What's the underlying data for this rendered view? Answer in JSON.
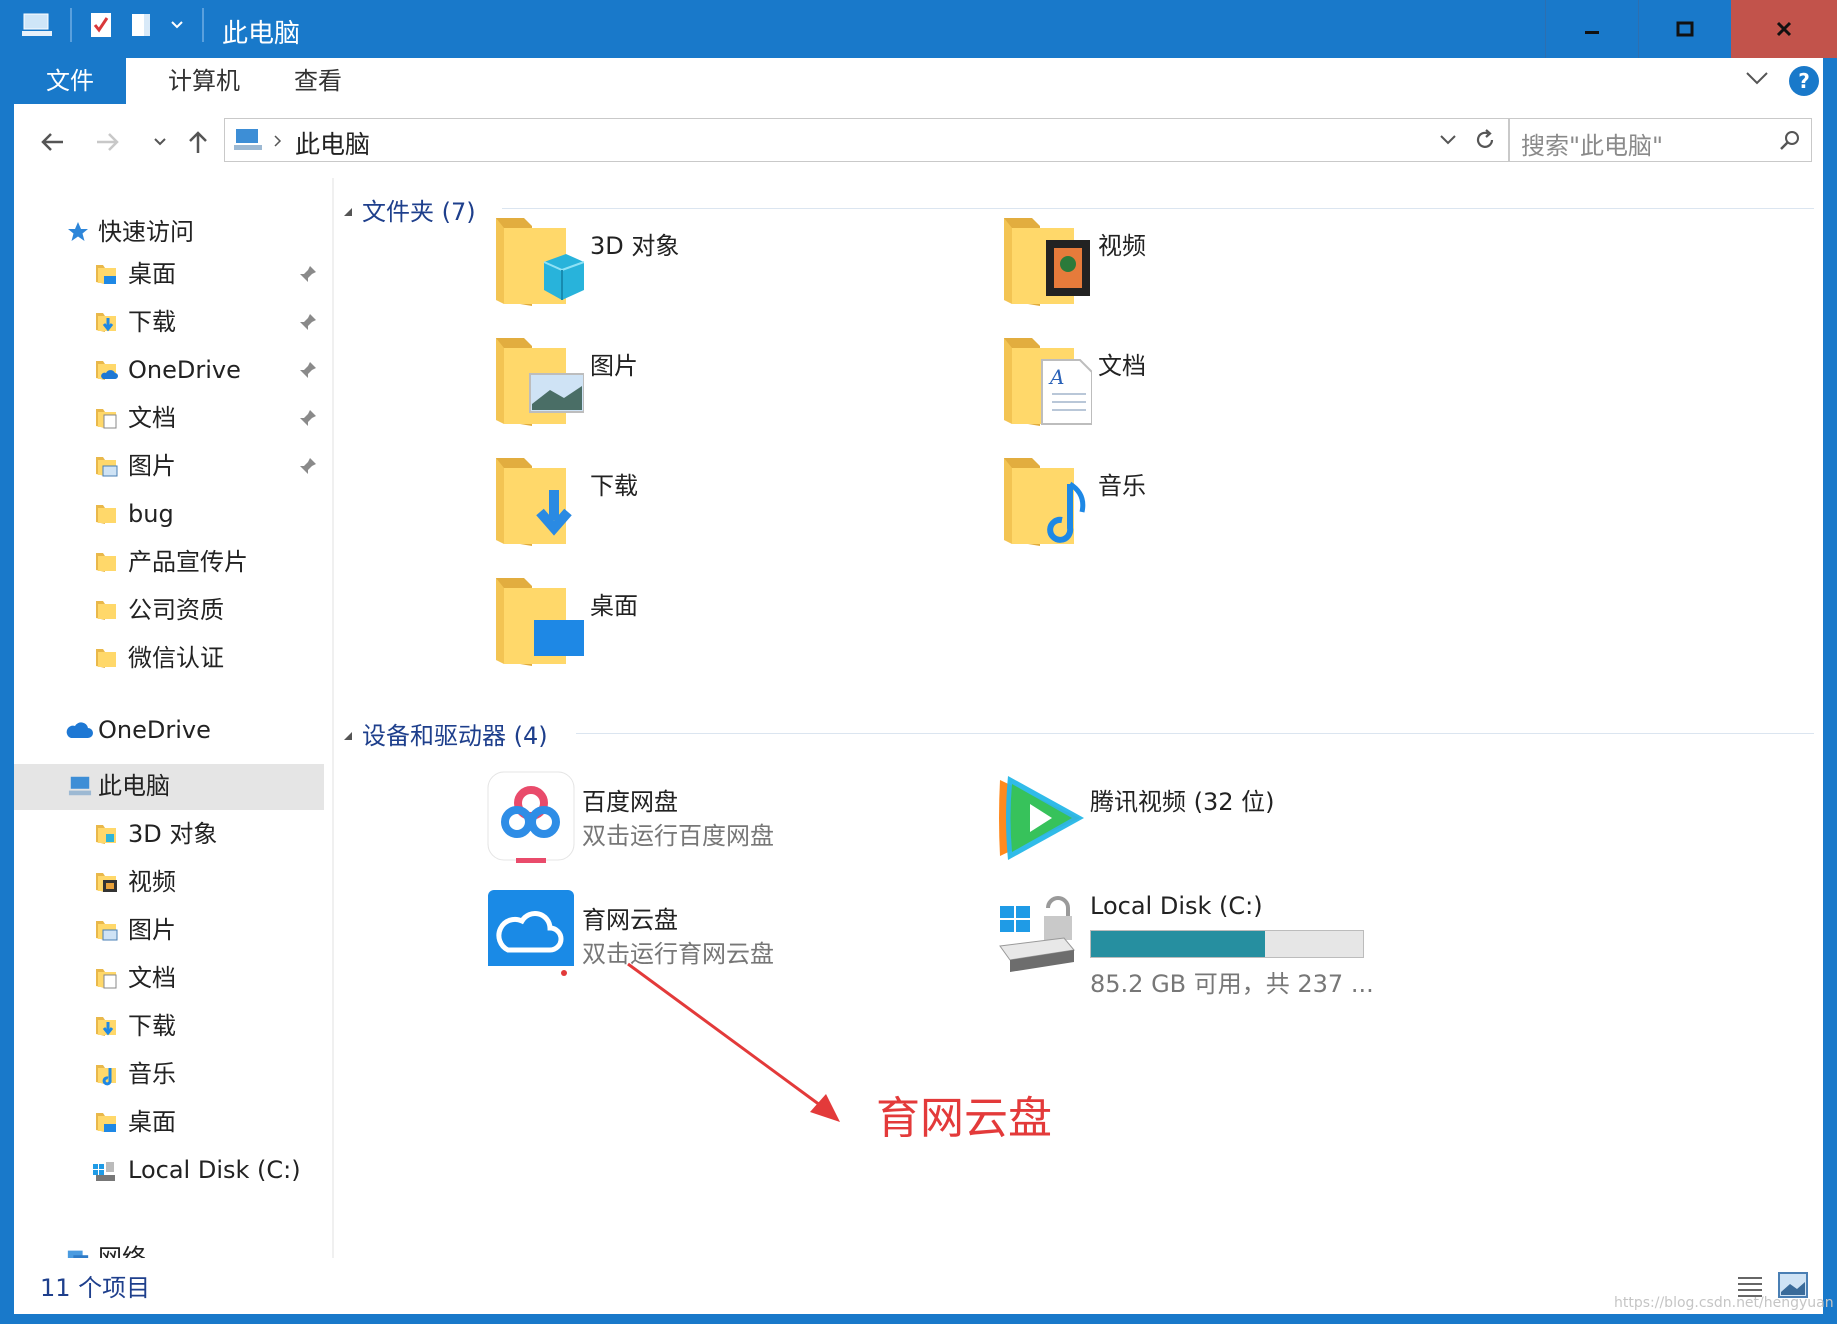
{
  "window": {
    "title": "此电脑"
  },
  "ribbon": {
    "tabs": [
      "文件",
      "计算机",
      "查看"
    ]
  },
  "address": {
    "location": "此电脑",
    "search_placeholder": "搜索\"此电脑\""
  },
  "sidebar": {
    "quick_access": "快速访问",
    "quick_items": [
      "桌面",
      "下载",
      "OneDrive",
      "文档",
      "图片",
      "bug",
      "产品宣传片",
      "公司资质",
      "微信认证"
    ],
    "onedrive": "OneDrive",
    "this_pc": "此电脑",
    "pc_items": [
      "3D 对象",
      "视频",
      "图片",
      "文档",
      "下载",
      "音乐",
      "桌面",
      "Local Disk (C:)"
    ],
    "network": "网络"
  },
  "content": {
    "folders_header": "文件夹 (7)",
    "folders": [
      "3D 对象",
      "视频",
      "图片",
      "文档",
      "下载",
      "音乐",
      "桌面"
    ],
    "devices_header": "设备和驱动器 (4)",
    "devices": [
      {
        "name": "百度网盘",
        "sub": "双击运行百度网盘"
      },
      {
        "name": "腾讯视频 (32 位)",
        "sub": ""
      },
      {
        "name": "育网云盘",
        "sub": "双击运行育网云盘"
      },
      {
        "name": "Local Disk (C:)",
        "sub": "85.2 GB 可用，共 237 ..."
      }
    ],
    "disk_usage_fraction": 0.64
  },
  "annotation": "育网云盘",
  "status": {
    "count": "11 个项目"
  },
  "watermark": "https://blog.csdn.net/hengyuan",
  "colors": {
    "titlebar": "#1979ca",
    "close": "#c2534b",
    "header_text": "#1e3f8c",
    "annotation": "#e33a3a",
    "disk_bar": "#268fa0"
  }
}
